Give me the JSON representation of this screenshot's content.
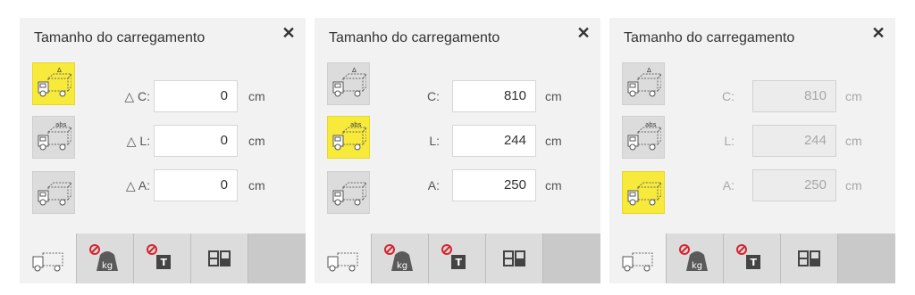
{
  "panels": [
    {
      "title": "Tamanho do carregamento",
      "close_label": "✕",
      "mode": "delta",
      "rows": [
        {
          "label": "△ C:",
          "value": "0",
          "unit": "cm"
        },
        {
          "label": "△ L:",
          "value": "0",
          "unit": "cm"
        },
        {
          "label": "△ A:",
          "value": "0",
          "unit": "cm"
        }
      ],
      "mode_icons": {
        "delta_badge": "Δ",
        "abs_badge": "abs"
      }
    },
    {
      "title": "Tamanho do carregamento",
      "close_label": "✕",
      "mode": "abs",
      "rows": [
        {
          "label": "C:",
          "value": "810",
          "unit": "cm"
        },
        {
          "label": "L:",
          "value": "244",
          "unit": "cm"
        },
        {
          "label": "A:",
          "value": "250",
          "unit": "cm"
        }
      ],
      "mode_icons": {
        "delta_badge": "Δ",
        "abs_badge": "abs"
      }
    },
    {
      "title": "Tamanho do carregamento",
      "close_label": "✕",
      "mode": "none",
      "rows": [
        {
          "label": "C:",
          "value": "810",
          "unit": "cm"
        },
        {
          "label": "L:",
          "value": "244",
          "unit": "cm"
        },
        {
          "label": "A:",
          "value": "250",
          "unit": "cm"
        }
      ],
      "mode_icons": {
        "delta_badge": "Δ",
        "abs_badge": "abs"
      }
    }
  ],
  "tabs": {
    "weight_label": "kg",
    "text_label": "T"
  },
  "colors": {
    "active_yellow": "#f7ea3b",
    "panel_bg": "#f2f2f2",
    "tab_bg": "#d0d0d0",
    "no_symbol_red": "#d9232e"
  }
}
